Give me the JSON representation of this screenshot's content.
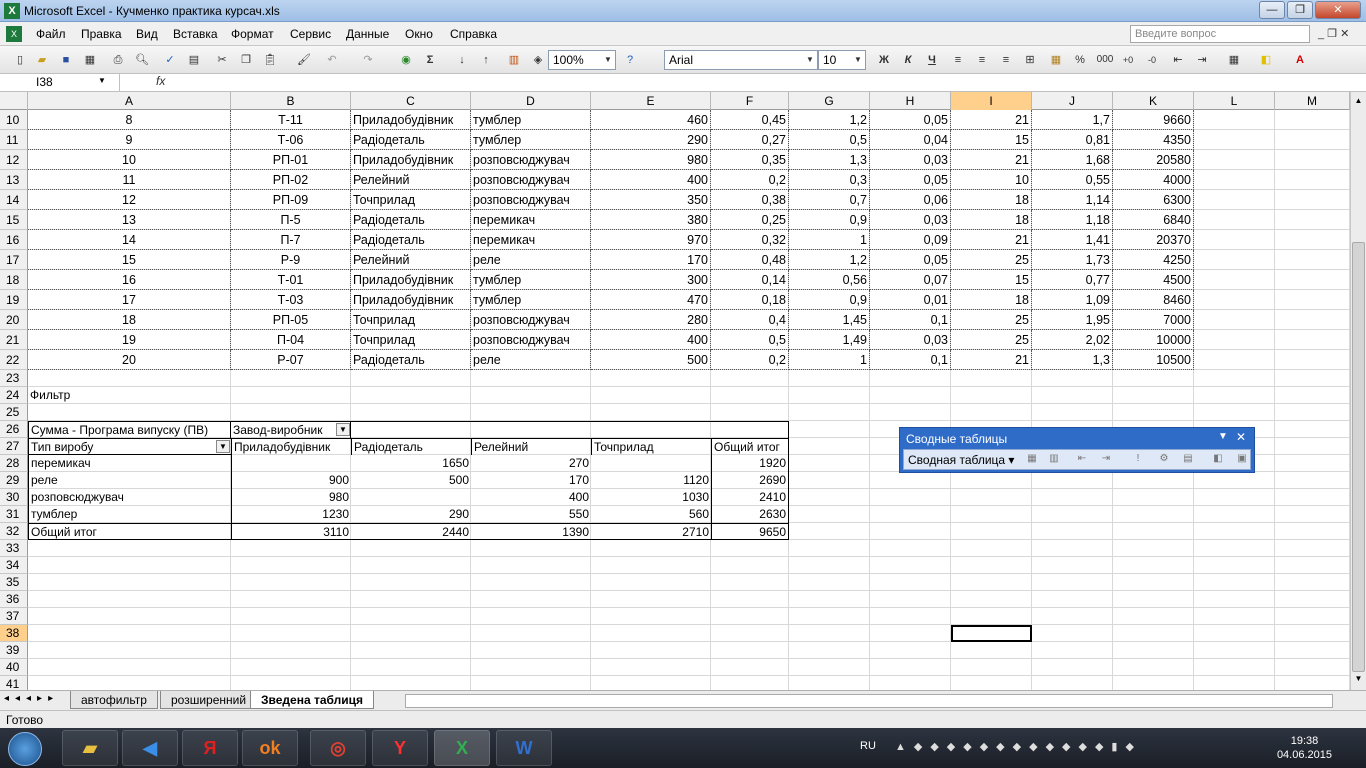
{
  "window": {
    "title": "Microsoft Excel - Кучменко практика курсач.xls",
    "min_label": "—",
    "restore_label": "❐",
    "close_label": "✕"
  },
  "menu": {
    "items": [
      "Файл",
      "Правка",
      "Вид",
      "Вставка",
      "Формат",
      "Сервис",
      "Данные",
      "Окно",
      "Справка"
    ],
    "search_placeholder": "Введите вопрос"
  },
  "toolbar": {
    "zoom": "100%",
    "font": "Arial",
    "size": "10",
    "bold": "Ж",
    "italic": "К",
    "underline": "Ч",
    "percent": "%",
    "thousands": "000"
  },
  "formula": {
    "namebox": "I38",
    "fx": "fx"
  },
  "columns": [
    "A",
    "B",
    "C",
    "D",
    "E",
    "F",
    "G",
    "H",
    "I",
    "J",
    "K",
    "L",
    "M"
  ],
  "selected_column": "I",
  "rows": [
    {
      "n": "10",
      "A": "8",
      "B": "Т-11",
      "C": "Приладобудівник",
      "D": "тумблер",
      "E": "460",
      "F": "0,45",
      "G": "1,2",
      "H": "0,05",
      "I": "21",
      "J": "1,7",
      "K": "9660"
    },
    {
      "n": "11",
      "A": "9",
      "B": "Т-06",
      "C": "Радіодеталь",
      "D": "тумблер",
      "E": "290",
      "F": "0,27",
      "G": "0,5",
      "H": "0,04",
      "I": "15",
      "J": "0,81",
      "K": "4350"
    },
    {
      "n": "12",
      "A": "10",
      "B": "РП-01",
      "C": "Приладобудівник",
      "D": "розповсюджувач",
      "E": "980",
      "F": "0,35",
      "G": "1,3",
      "H": "0,03",
      "I": "21",
      "J": "1,68",
      "K": "20580"
    },
    {
      "n": "13",
      "A": "11",
      "B": "РП-02",
      "C": "Релейний",
      "D": "розповсюджувач",
      "E": "400",
      "F": "0,2",
      "G": "0,3",
      "H": "0,05",
      "I": "10",
      "J": "0,55",
      "K": "4000"
    },
    {
      "n": "14",
      "A": "12",
      "B": "РП-09",
      "C": "Точприлад",
      "D": "розповсюджувач",
      "E": "350",
      "F": "0,38",
      "G": "0,7",
      "H": "0,06",
      "I": "18",
      "J": "1,14",
      "K": "6300"
    },
    {
      "n": "15",
      "A": "13",
      "B": "П-5",
      "C": "Радіодеталь",
      "D": "перемикач",
      "E": "380",
      "F": "0,25",
      "G": "0,9",
      "H": "0,03",
      "I": "18",
      "J": "1,18",
      "K": "6840"
    },
    {
      "n": "16",
      "A": "14",
      "B": "П-7",
      "C": "Радіодеталь",
      "D": "перемикач",
      "E": "970",
      "F": "0,32",
      "G": "1",
      "H": "0,09",
      "I": "21",
      "J": "1,41",
      "K": "20370"
    },
    {
      "n": "17",
      "A": "15",
      "B": "Р-9",
      "C": "Релейний",
      "D": "реле",
      "E": "170",
      "F": "0,48",
      "G": "1,2",
      "H": "0,05",
      "I": "25",
      "J": "1,73",
      "K": "4250"
    },
    {
      "n": "18",
      "A": "16",
      "B": "Т-01",
      "C": "Приладобудівник",
      "D": "тумблер",
      "E": "300",
      "F": "0,14",
      "G": "0,56",
      "H": "0,07",
      "I": "15",
      "J": "0,77",
      "K": "4500"
    },
    {
      "n": "19",
      "A": "17",
      "B": "Т-03",
      "C": "Приладобудівник",
      "D": "тумблер",
      "E": "470",
      "F": "0,18",
      "G": "0,9",
      "H": "0,01",
      "I": "18",
      "J": "1,09",
      "K": "8460"
    },
    {
      "n": "20",
      "A": "18",
      "B": "РП-05",
      "C": "Точприлад",
      "D": "розповсюджувач",
      "E": "280",
      "F": "0,4",
      "G": "1,45",
      "H": "0,1",
      "I": "25",
      "J": "1,95",
      "K": "7000"
    },
    {
      "n": "21",
      "A": "19",
      "B": "П-04",
      "C": "Точприлад",
      "D": "розповсюджувач",
      "E": "400",
      "F": "0,5",
      "G": "1,49",
      "H": "0,03",
      "I": "25",
      "J": "2,02",
      "K": "10000"
    },
    {
      "n": "22",
      "A": "20",
      "B": "Р-07",
      "C": "Радіодеталь",
      "D": "реле",
      "E": "500",
      "F": "0,2",
      "G": "1",
      "H": "0,1",
      "I": "21",
      "J": "1,3",
      "K": "10500"
    }
  ],
  "pivot": {
    "filter_label": "Фильтр",
    "sum_label": "Сумма - Програма випуску (ПВ)",
    "col_field": "Завод-виробник",
    "row_field": "Тип виробу",
    "headers": [
      "Приладобудівник",
      "Радіодеталь",
      "Релейний",
      "Точприлад",
      "Общий итог"
    ],
    "rows": [
      {
        "label": "перемикач",
        "vals": [
          "",
          "1650",
          "270",
          "",
          "1920"
        ]
      },
      {
        "label": "реле",
        "vals": [
          "900",
          "500",
          "170",
          "1120",
          "2690"
        ]
      },
      {
        "label": "розповсюджувач",
        "vals": [
          "980",
          "",
          "400",
          "1030",
          "2410"
        ]
      },
      {
        "label": "тумблер",
        "vals": [
          "1230",
          "290",
          "550",
          "560",
          "2630"
        ]
      },
      {
        "label": "Общий итог",
        "vals": [
          "3110",
          "2440",
          "1390",
          "2710",
          "9650"
        ]
      }
    ]
  },
  "row_numbers_after": [
    "23",
    "24",
    "25",
    "26",
    "27",
    "28",
    "29",
    "30",
    "31",
    "32",
    "33",
    "34",
    "35",
    "36",
    "37",
    "38",
    "39",
    "40",
    "41"
  ],
  "selected_row": "38",
  "pivot_panel": {
    "title": "Сводные таблицы",
    "button": "Сводная таблица"
  },
  "sheets": [
    "автофильтр",
    "розширенний",
    "Зведена таблиця"
  ],
  "active_sheet": "Зведена таблиця",
  "status": "Готово",
  "taskbar": {
    "lang": "RU",
    "time": "19:38",
    "date": "04.06.2015"
  }
}
